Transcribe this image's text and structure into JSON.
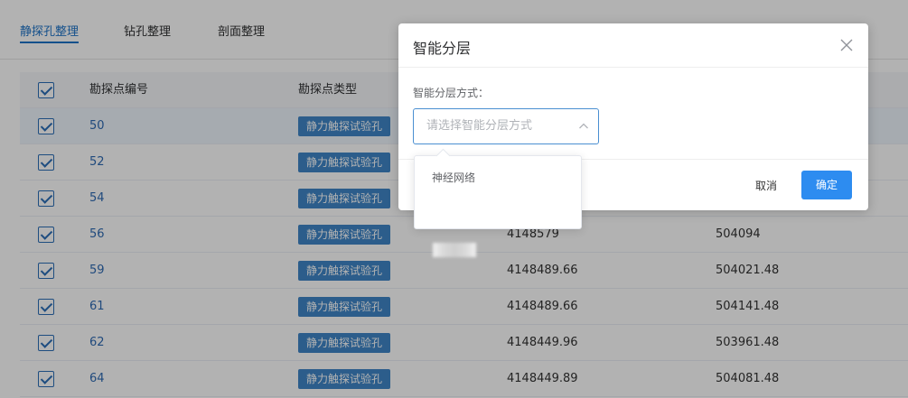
{
  "tabs": [
    {
      "label": "静探孔整理",
      "active": true
    },
    {
      "label": "钻孔整理",
      "active": false
    },
    {
      "label": "剖面整理",
      "active": false
    }
  ],
  "table": {
    "headers": [
      "勘探点编号",
      "勘探点类型"
    ],
    "rows": [
      {
        "id": "50",
        "type": "静力触探试验孔",
        "x": "",
        "y": ""
      },
      {
        "id": "52",
        "type": "静力触探试验孔",
        "x": "",
        "y": ""
      },
      {
        "id": "54",
        "type": "静力触探试验孔",
        "x": "",
        "y": ""
      },
      {
        "id": "56",
        "type": "静力触探试验孔",
        "x": "4148579",
        "y": "504094"
      },
      {
        "id": "59",
        "type": "静力触探试验孔",
        "x": "4148489.66",
        "y": "504021.48"
      },
      {
        "id": "61",
        "type": "静力触探试验孔",
        "x": "4148489.66",
        "y": "504141.48"
      },
      {
        "id": "62",
        "type": "静力触探试验孔",
        "x": "4148449.96",
        "y": "503961.48"
      },
      {
        "id": "64",
        "type": "静力触探试验孔",
        "x": "4148449.89",
        "y": "504081.48"
      }
    ]
  },
  "dialog": {
    "title": "智能分层",
    "form_label": "智能分层方式：",
    "select_placeholder": "请选择智能分层方式",
    "cancel_label": "取消",
    "confirm_label": "确定"
  },
  "dropdown": {
    "options": [
      {
        "label": "神经网络",
        "obscured": false
      },
      {
        "label": "",
        "obscured": true
      }
    ]
  },
  "colors": {
    "accent": "#1e73c8",
    "tag": "#3f86c8",
    "primary_button": "#2d8cf0"
  }
}
